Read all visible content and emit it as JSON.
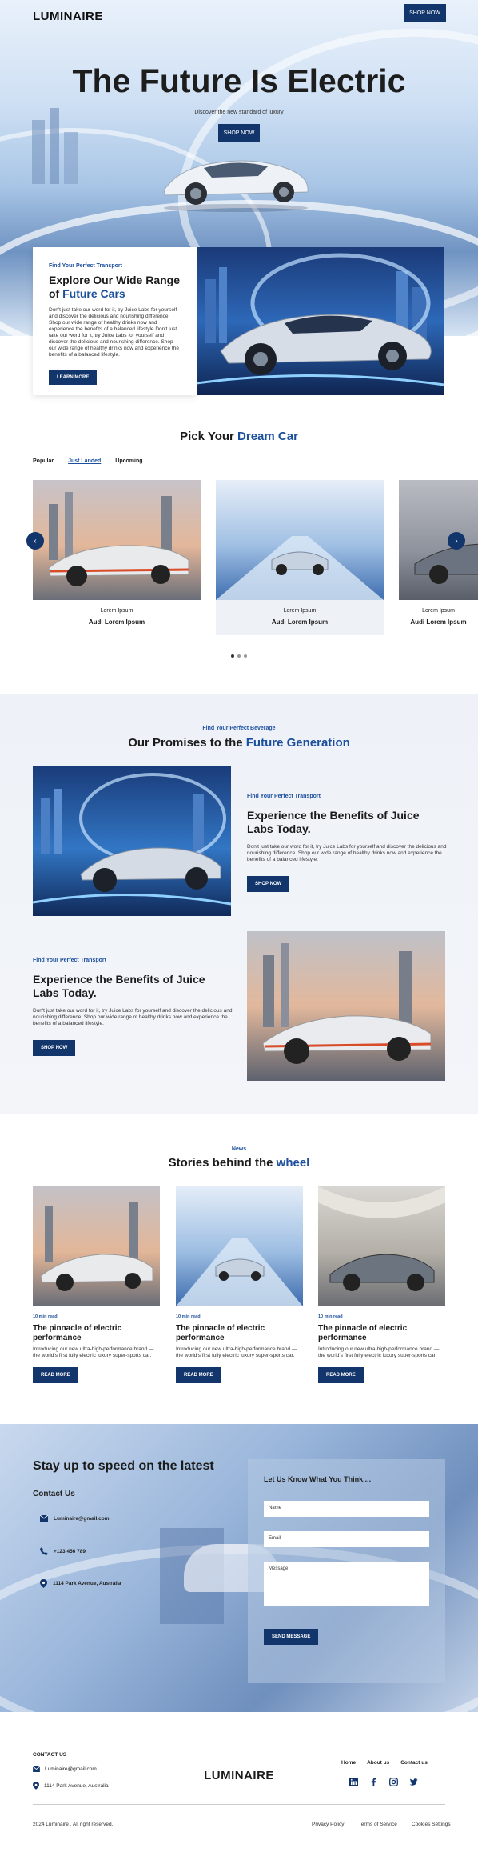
{
  "brand": "LUMINAIRE",
  "header": {
    "shop_now": "SHOP NOW"
  },
  "hero": {
    "title": "The Future Is Electric",
    "subtitle": "Discover the new standard of luxury",
    "button": "SHOP NOW"
  },
  "explore": {
    "eyebrow": "Find Your Perfect Transport",
    "title_a": "Explore Our Wide Range of",
    "title_b": "Future Cars",
    "body": "Don't just take our word for it, try Juice Labs for yourself and discover the delicious and nourishing difference. Shop our wide range of healthy drinks now and experience the benefits of a balanced lifestyle.Don't just take our word for it, try Juice Labs for yourself and discover the delicious and nourishing difference. Shop our wide range of healthy drinks now and experience the benefits of a balanced lifestyle.",
    "button": "LEARN MORE"
  },
  "pick": {
    "title_a": "Pick Your ",
    "title_b": "Dream Car",
    "tabs": [
      "Popular",
      "Just Landed",
      "Upcoming"
    ],
    "active_tab": "Just Landed",
    "cards": [
      {
        "line1": "Lorem Ipsum",
        "line2": "Audi Lorem Ipsum"
      },
      {
        "line1": "Lorem Ipsum",
        "line2": "Audi Lorem Ipsum"
      },
      {
        "line1": "Lorem Ipsum",
        "line2": "Audi Lorem Ipsum"
      }
    ],
    "prev": "‹",
    "next": "›"
  },
  "promises": {
    "eyebrow": "Find Your Perfect Beverage",
    "title_a": "Our Promises to the ",
    "title_b": "Future Generation",
    "blocks": [
      {
        "eyebrow": "Find Your Perfect Transport",
        "title": "Experience the Benefits of Juice Labs Today.",
        "body": "Don't just take our word for it, try Juice Labs for yourself and discover the delicious and nourishing difference. Shop our wide range of healthy drinks now and experience the benefits of a balanced lifestyle.",
        "button": "SHOP NOW"
      },
      {
        "eyebrow": "Find Your Perfect Transport",
        "title": "Experience the Benefits of Juice Labs Today.",
        "body": "Don't just take our word for it, try Juice Labs for yourself and discover the delicious and nourishing difference. Shop our wide range of healthy drinks now and experience the benefits of a balanced lifestyle.",
        "button": "SHOP NOW"
      }
    ]
  },
  "news": {
    "eyebrow": "News",
    "title_a": "Stories behind the ",
    "title_b": "wheel",
    "cards": [
      {
        "tag": "10 min read",
        "title": "The pinnacle of electric performance",
        "body": "Introducing our new ultra-high-performance brand — the world's first fully electric luxury super-sports car.",
        "button": "READ MORE"
      },
      {
        "tag": "10 min read",
        "title": "The pinnacle of electric performance",
        "body": "Introducing our new ultra-high-performance brand — the world's first fully electric luxury super-sports car.",
        "button": "READ MORE"
      },
      {
        "tag": "10 min read",
        "title": "The pinnacle of electric performance",
        "body": "Introducing our new ultra-high-performance brand — the world's first fully electric luxury super-sports car.",
        "button": "READ MORE"
      }
    ]
  },
  "contact": {
    "title": "Stay up to speed on the latest",
    "subtitle": "Contact Us",
    "email": "Luminaire@gmail.com",
    "phone": "+123 456 789",
    "address": "1114 Park Avenue, Australia",
    "form": {
      "title": "Let Us Know What You Think....",
      "name": "Name",
      "email": "Email",
      "message": "Message",
      "button": "SEND MESSAGE"
    }
  },
  "footer": {
    "contact_heading": "CONTACT US",
    "email": "Luminaire@gmail.com",
    "address": "1114 Park Avenue, Australia",
    "links": [
      "Home",
      "About us",
      "Contact us"
    ],
    "copyright": "2024 Luminaire . All right reserved.",
    "bottom_links": [
      "Privacy Policy",
      "Terms of Service",
      "Cookies Settings"
    ],
    "social": [
      "linkedin-icon",
      "facebook-icon",
      "instagram-icon",
      "twitter-icon"
    ]
  },
  "colors": {
    "primary": "#12356b",
    "accent": "#1c4f9c"
  }
}
